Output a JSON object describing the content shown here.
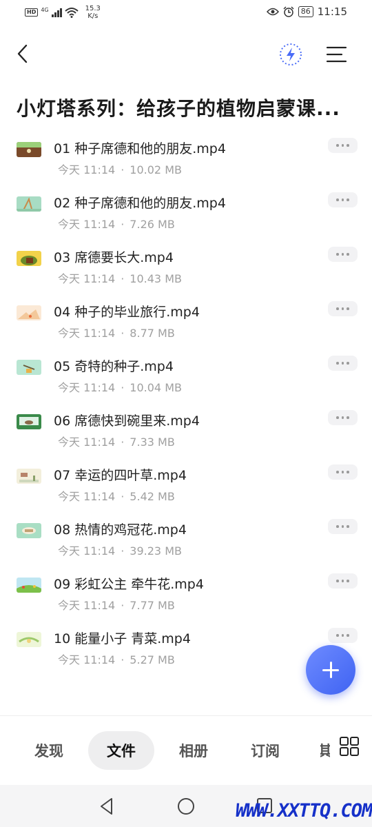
{
  "status_bar": {
    "hd": "HD",
    "network": "4G",
    "speed_value": "15.3",
    "speed_unit": "K/s",
    "battery": "86",
    "time": "11:15"
  },
  "header": {
    "title": "小灯塔系列：给孩子的植物启蒙课..."
  },
  "files": [
    {
      "name": "01 种子席德和他的朋友.mp4",
      "date": "今天 11:14",
      "size": "10.02 MB"
    },
    {
      "name": "02 种子席德和他的朋友.mp4",
      "date": "今天 11:14",
      "size": "7.26 MB"
    },
    {
      "name": "03 席德要长大.mp4",
      "date": "今天 11:14",
      "size": "10.43 MB"
    },
    {
      "name": "04 种子的毕业旅行.mp4",
      "date": "今天 11:14",
      "size": "8.77 MB"
    },
    {
      "name": "05 奇特的种子.mp4",
      "date": "今天 11:14",
      "size": "10.04 MB"
    },
    {
      "name": "06 席德快到碗里来.mp4",
      "date": "今天 11:14",
      "size": "7.33 MB"
    },
    {
      "name": "07 幸运的四叶草.mp4",
      "date": "今天 11:14",
      "size": "5.42 MB"
    },
    {
      "name": "08 热情的鸡冠花.mp4",
      "date": "今天 11:14",
      "size": "39.23 MB"
    },
    {
      "name": "09 彩虹公主 牵牛花.mp4",
      "date": "今天 11:14",
      "size": "7.77 MB"
    },
    {
      "name": "10 能量小子 青菜.mp4",
      "date": "今天 11:14",
      "size": "5.27 MB"
    }
  ],
  "meta_separator": "·",
  "tabs": [
    {
      "label": "发现"
    },
    {
      "label": "文件"
    },
    {
      "label": "相册"
    },
    {
      "label": "订阅"
    }
  ],
  "tab_partial": "其",
  "watermark": "WWW.XXTTQ.COM",
  "colors": {
    "accent": "#4a6cf7",
    "meta_text": "#a0a0a0",
    "active_tab_bg": "#eeeeef",
    "watermark": "#1631c9"
  },
  "icons": {
    "back": "chevron-left-icon",
    "flash": "lightning-icon",
    "menu": "menu-icon",
    "more": "ellipsis-icon",
    "add": "plus-icon",
    "grid": "grid-icon",
    "nav_back": "triangle-back-icon",
    "nav_home": "circle-home-icon",
    "nav_recent": "square-recent-icon"
  }
}
